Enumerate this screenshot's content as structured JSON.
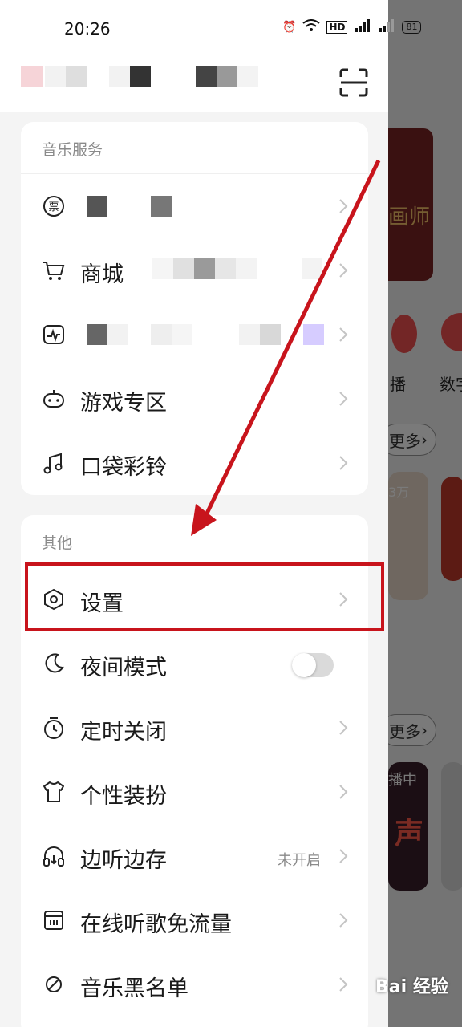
{
  "status_bar": {
    "time": "20:26",
    "battery": "81"
  },
  "music_services": {
    "title": "音乐服务",
    "items": [
      {
        "label": "",
        "icon": "ticket-icon"
      },
      {
        "label": "商城",
        "icon": "cart-icon"
      },
      {
        "label": "",
        "icon": "activity-icon"
      },
      {
        "label": "游戏专区",
        "icon": "gamepad-icon"
      },
      {
        "label": "口袋彩铃",
        "icon": "ringtone-icon"
      }
    ]
  },
  "other": {
    "title": "其他",
    "items": [
      {
        "label": "设置",
        "icon": "hexagon-settings-icon"
      },
      {
        "label": "夜间模式",
        "icon": "moon-icon",
        "toggle": false
      },
      {
        "label": "定时关闭",
        "icon": "timer-icon"
      },
      {
        "label": "个性装扮",
        "icon": "tshirt-icon"
      },
      {
        "label": "边听边存",
        "icon": "headphones-icon",
        "status": "未开启"
      },
      {
        "label": "在线听歌免流量",
        "icon": "sim-card-icon"
      },
      {
        "label": "音乐黑名单",
        "icon": "block-icon"
      }
    ]
  },
  "background_app": {
    "banner_text": "画师",
    "live_label": "播",
    "digital_label": "数字",
    "more_1": "更多",
    "more_2": "更多",
    "count_badge": "3万",
    "now_playing": "播中",
    "big_text": "声"
  },
  "watermark": "Bai 经验",
  "colors": {
    "accent_red": "#c8141c",
    "card_bg": "#ffffff",
    "page_bg": "#f4f4f4"
  }
}
